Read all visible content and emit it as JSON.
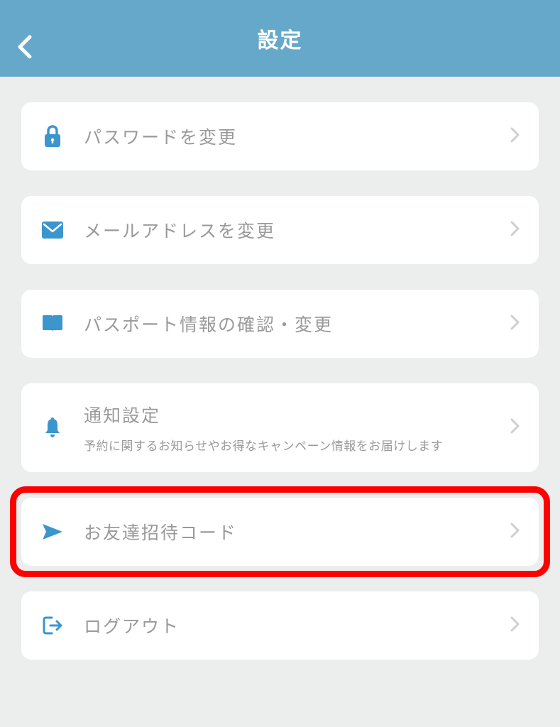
{
  "header": {
    "title": "設定"
  },
  "items": [
    {
      "label": "パスワードを変更"
    },
    {
      "label": "メールアドレスを変更"
    },
    {
      "label": "パスポート情報の確認・変更"
    },
    {
      "label": "通知設定",
      "sublabel": "予約に関するお知らせやお得なキャンペーン情報をお届けします"
    },
    {
      "label": "お友達招待コード"
    },
    {
      "label": "ログアウト"
    }
  ],
  "colors": {
    "accent": "#3a96cd",
    "headerBg": "#66a8c9"
  }
}
